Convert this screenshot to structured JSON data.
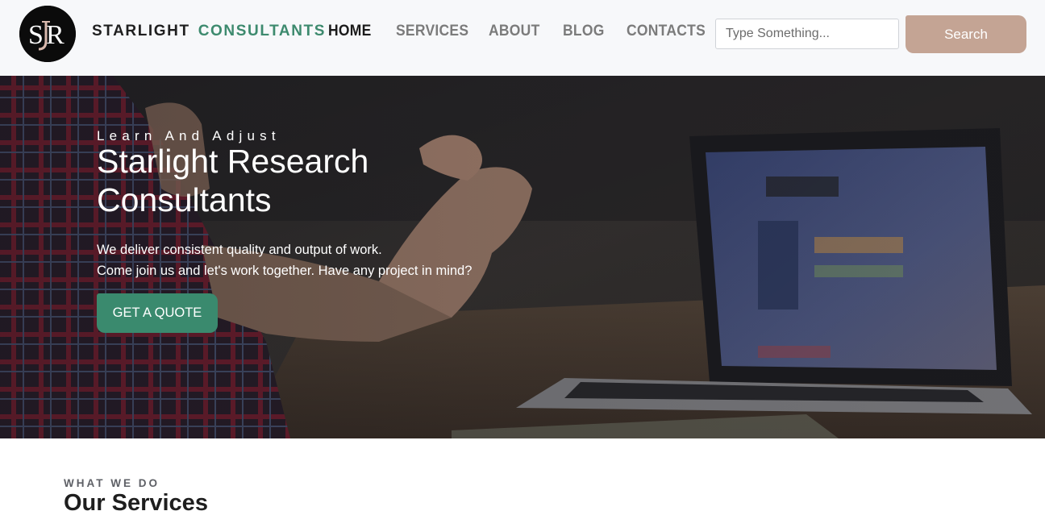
{
  "header": {
    "logo_text": "SJR",
    "brand": {
      "part1": "STARLIGHT",
      "part2": "CONSULTANTS"
    },
    "nav": [
      {
        "label": "HOME",
        "active": true
      },
      {
        "label": "SERVICES",
        "active": false
      },
      {
        "label": "ABOUT",
        "active": false
      },
      {
        "label": "BLOG",
        "active": false
      },
      {
        "label": "CONTACTS",
        "active": false
      }
    ],
    "search": {
      "placeholder": "Type Something...",
      "value": "",
      "button_label": "Search"
    }
  },
  "hero": {
    "kicker": "Learn And Adjust",
    "title_line1": "Starlight Research",
    "title_line2": "Consultants",
    "desc_line1": "We deliver consistent quality and output of work.",
    "desc_line2": "Come join us and let's work together. Have any project in mind?",
    "cta_label": "GET A QUOTE"
  },
  "services": {
    "kicker": "WHAT WE DO",
    "title": "Our Services"
  },
  "colors": {
    "brand_accent": "#3d8a6e",
    "search_button": "#c4a494",
    "cta_button": "#3a8a6e",
    "header_bg": "#f7f8fa"
  }
}
